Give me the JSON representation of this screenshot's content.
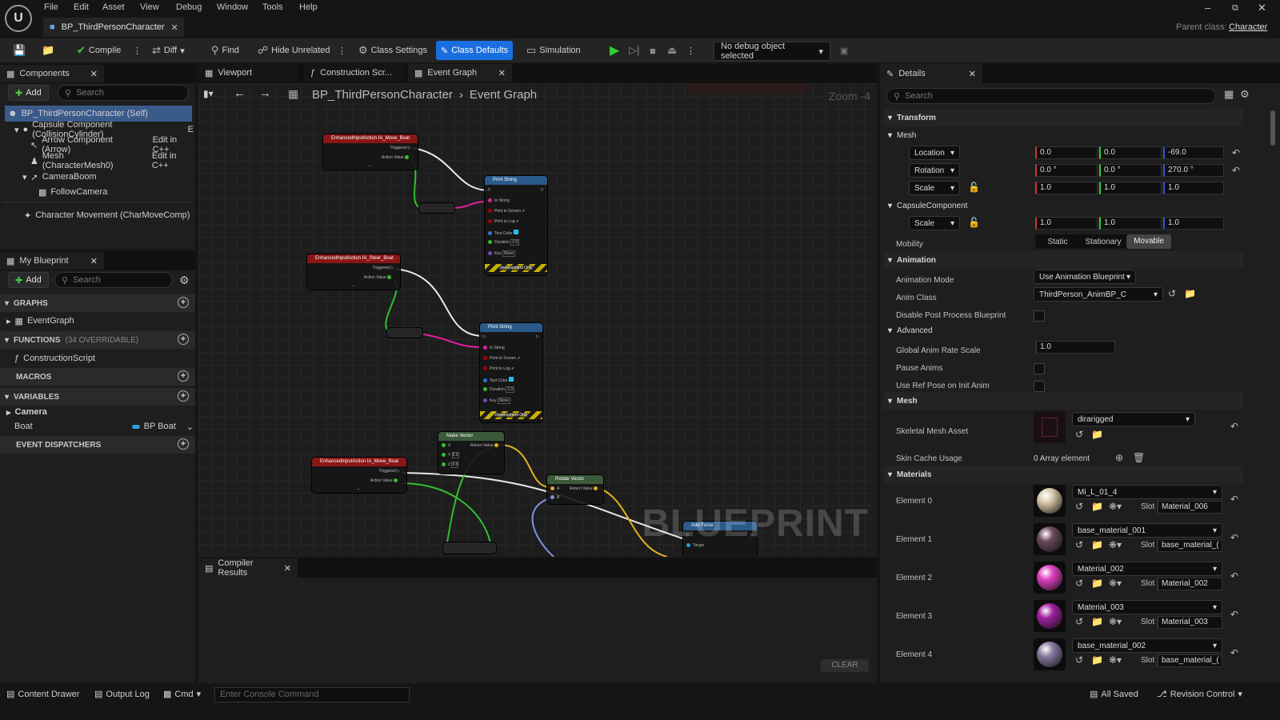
{
  "menu": [
    "File",
    "Edit",
    "Asset",
    "View",
    "Debug",
    "Window",
    "Tools",
    "Help"
  ],
  "document_tab": "BP_ThirdPersonCharacter",
  "parent_class_label": "Parent class:",
  "parent_class_value": "Character",
  "toolbar": {
    "compile": "Compile",
    "diff": "Diff",
    "find": "Find",
    "hide_unrelated": "Hide Unrelated",
    "class_settings": "Class Settings",
    "class_defaults": "Class Defaults",
    "simulation": "Simulation",
    "debug_object": "No debug object selected"
  },
  "components": {
    "tab": "Components",
    "add": "Add",
    "search_placeholder": "Search",
    "items": [
      {
        "label": "BP_ThirdPersonCharacter (Self)"
      },
      {
        "label": "Capsule Component (CollisionCylinder)",
        "link": "E"
      },
      {
        "label": "Arrow Component (Arrow)",
        "link": "Edit in C++"
      },
      {
        "label": "Mesh (CharacterMesh0)",
        "link": "Edit in C++"
      },
      {
        "label": "CameraBoom"
      },
      {
        "label": "FollowCamera"
      },
      {
        "label": "Character Movement (CharMoveComp)"
      }
    ]
  },
  "my_blueprint": {
    "tab": "My Blueprint",
    "add": "Add",
    "search_placeholder": "Search",
    "graphs": "GRAPHS",
    "event_graph": "EventGraph",
    "functions": "FUNCTIONS",
    "functions_count": "(34 OVERRIDABLE)",
    "construction_script": "ConstructionScript",
    "macros": "MACROS",
    "variables": "VARIABLES",
    "camera": "Camera",
    "boat_var": "Boat",
    "boat_type": "BP Boat",
    "event_dispatchers": "EVENT DISPATCHERS"
  },
  "graph_tabs": [
    "Viewport",
    "Construction Scr...",
    "Event Graph"
  ],
  "breadcrumb": {
    "root": "BP_ThirdPersonCharacter",
    "current": "Event Graph"
  },
  "zoom": "Zoom -4",
  "watermark": "BLUEPRINT",
  "nodes": {
    "ia_move_boat": "EnhancedInputAction IA_Move_Boat",
    "ia_steer_boat": "EnhancedInputAction IA_Steer_Boat",
    "ia_move_boat_2": "EnhancedInputAction IA_Move_Boat",
    "print_string": "Print String",
    "make_vector": "Make Vector",
    "rotate_vector": "Rotate Vector",
    "add_force": "Add Force",
    "triggered": "Triggered",
    "action_value": "Action Value",
    "in_string": "In String",
    "print_to_screen": "Print to Screen",
    "print_to_log": "Print to Log",
    "text_color": "Text Color",
    "duration": "Duration",
    "duration_val": "2.0",
    "key": "Key",
    "key_val": "None",
    "dev_only": "Development Only",
    "return_value": "Return Value",
    "x": "X",
    "y": "Y",
    "z": "Z",
    "zero": "0.0",
    "a": "A",
    "b": "B",
    "target": "Target"
  },
  "compiler": {
    "tab": "Compiler Results",
    "clear": "CLEAR"
  },
  "details": {
    "tab": "Details",
    "search_placeholder": "Search",
    "transform": "Transform",
    "mesh_sub": "Mesh",
    "location": "Location",
    "rotation": "Rotation",
    "scale": "Scale",
    "loc": [
      "0.0",
      "0.0",
      "-69.0"
    ],
    "rot": [
      "0.0 °",
      "0.0 °",
      "270.0 °"
    ],
    "scl": [
      "1.0",
      "1.0",
      "1.0"
    ],
    "capsule": "CapsuleComponent",
    "cap_scale": [
      "1.0",
      "1.0",
      "1.0"
    ],
    "mobility": "Mobility",
    "mobility_opts": [
      "Static",
      "Stationary",
      "Movable"
    ],
    "animation": "Animation",
    "anim_mode_label": "Animation Mode",
    "anim_mode": "Use Animation Blueprint",
    "anim_class_label": "Anim Class",
    "anim_class": "ThirdPerson_AnimBP_C",
    "disable_ppb": "Disable Post Process Blueprint",
    "advanced": "Advanced",
    "global_rate_label": "Global Anim Rate Scale",
    "global_rate": "1.0",
    "pause_anims": "Pause Anims",
    "use_ref_pose": "Use Ref Pose on Init Anim",
    "mesh": "Mesh",
    "skel_mesh_label": "Skeletal Mesh Asset",
    "skel_mesh": "dirarigged",
    "skin_cache_label": "Skin Cache Usage",
    "skin_cache": "0 Array element",
    "materials": "Materials",
    "slot": "Slot",
    "elements": [
      {
        "label": "Element 0",
        "material": "Mi_L_01_4",
        "slot": "Material_006",
        "color": "#d8c8a8"
      },
      {
        "label": "Element 1",
        "material": "base_material_001",
        "slot": "base_material_(",
        "color": "#6a4a5a"
      },
      {
        "label": "Element 2",
        "material": "Material_002",
        "slot": "Material_002",
        "color": "#e040c0"
      },
      {
        "label": "Element 3",
        "material": "Material_003",
        "slot": "Material_003",
        "color": "#a020a0"
      },
      {
        "label": "Element 4",
        "material": "base_material_002",
        "slot": "base_material_(",
        "color": "#8a7aa0"
      }
    ]
  },
  "statusbar": {
    "content_drawer": "Content Drawer",
    "output_log": "Output Log",
    "cmd": "Cmd",
    "console_placeholder": "Enter Console Command",
    "all_saved": "All Saved",
    "revision_control": "Revision Control"
  }
}
